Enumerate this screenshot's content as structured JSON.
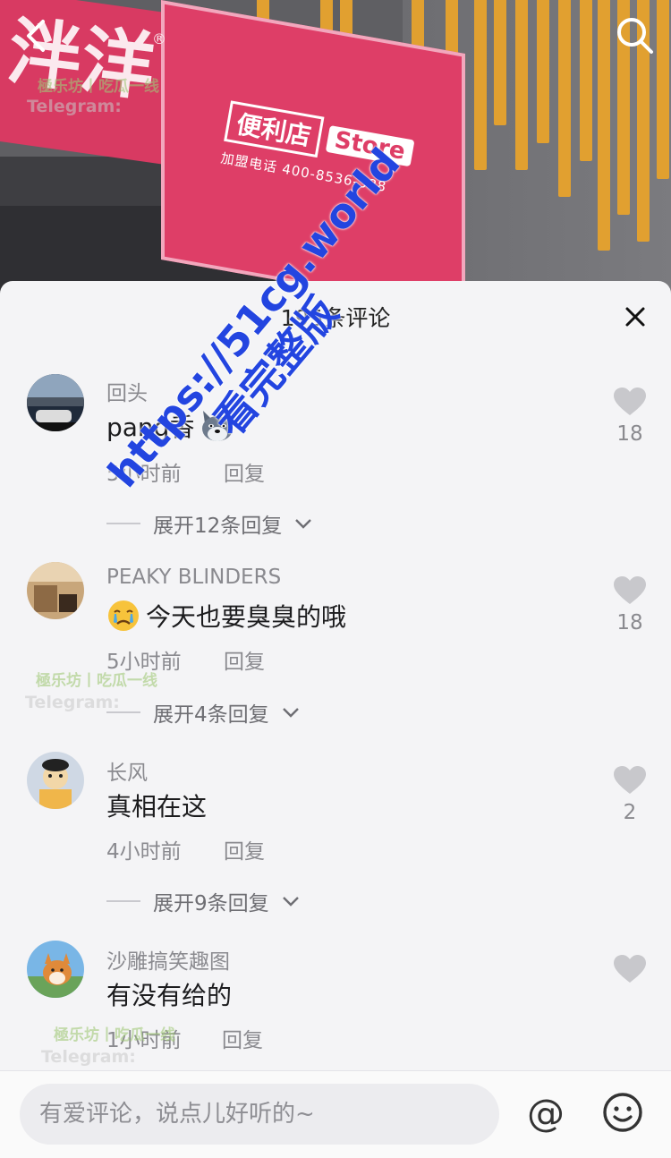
{
  "background": {
    "brand_char": "泮洋",
    "store_cn": "便利店",
    "store_en": "Store",
    "store_phone": "加盟电话 400-8536-388"
  },
  "sheet": {
    "title": "195条评论"
  },
  "comments": [
    {
      "name": "回头",
      "text": "pang香",
      "emoji": "dog-face-emoji",
      "time": "5小时前",
      "reply": "回复",
      "likes": "18",
      "expand": "展开12条回复"
    },
    {
      "name": "PEAKY BLINDERS",
      "text": "今天也要臭臭的哦",
      "emoji": "crying-face-emoji",
      "time": "5小时前",
      "reply": "回复",
      "likes": "18",
      "expand": "展开4条回复"
    },
    {
      "name": "长风",
      "text": "真相在这",
      "time": "4小时前",
      "reply": "回复",
      "likes": "2",
      "expand": "展开9条回复"
    },
    {
      "name": "沙雕搞笑趣图",
      "text": "有没有给的",
      "time": "1小时前",
      "reply": "回复",
      "likes": ""
    }
  ],
  "input": {
    "placeholder": "有爱评论，说点儿好听的~",
    "at_label": "@"
  },
  "watermarks": {
    "small": "極乐坊丨吃瓜一线",
    "telegram": "Telegram:",
    "big_line1": "https://51cg.world",
    "big_line2": "看完整版"
  },
  "colors": {
    "accent_sign": "#de3e67",
    "slat": "#e1a030",
    "watermark_blue": "#2345e0"
  }
}
